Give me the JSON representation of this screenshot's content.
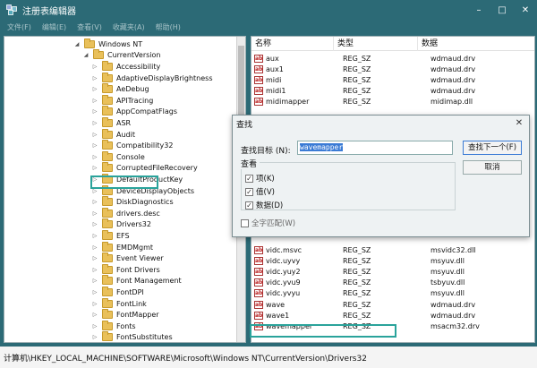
{
  "window": {
    "title": "注册表编辑器"
  },
  "menu": [
    "文件(F)",
    "编辑(E)",
    "查看(V)",
    "收藏夹(A)",
    "帮助(H)"
  ],
  "tree": {
    "nodes": [
      {
        "label": "Windows NT",
        "level": 0,
        "expanded": true
      },
      {
        "label": "CurrentVersion",
        "level": 1,
        "expanded": true
      },
      {
        "label": "Accessibility",
        "level": 2
      },
      {
        "label": "AdaptiveDisplayBrightness",
        "level": 2
      },
      {
        "label": "AeDebug",
        "level": 2
      },
      {
        "label": "APITracing",
        "level": 2
      },
      {
        "label": "AppCompatFlags",
        "level": 2
      },
      {
        "label": "ASR",
        "level": 2
      },
      {
        "label": "Audit",
        "level": 2
      },
      {
        "label": "Compatibility32",
        "level": 2
      },
      {
        "label": "Console",
        "level": 2
      },
      {
        "label": "CorruptedFileRecovery",
        "level": 2
      },
      {
        "label": "DefaultProductKey",
        "level": 2
      },
      {
        "label": "DeviceDisplayObjects",
        "level": 2
      },
      {
        "label": "DiskDiagnostics",
        "level": 2
      },
      {
        "label": "drivers.desc",
        "level": 2
      },
      {
        "label": "Drivers32",
        "level": 2,
        "selected": true
      },
      {
        "label": "EFS",
        "level": 2
      },
      {
        "label": "EMDMgmt",
        "level": 2
      },
      {
        "label": "Event Viewer",
        "level": 2
      },
      {
        "label": "Font Drivers",
        "level": 2
      },
      {
        "label": "Font Management",
        "level": 2
      },
      {
        "label": "FontDPI",
        "level": 2
      },
      {
        "label": "FontLink",
        "level": 2
      },
      {
        "label": "FontMapper",
        "level": 2
      },
      {
        "label": "Fonts",
        "level": 2
      },
      {
        "label": "FontSubstitutes",
        "level": 2
      }
    ]
  },
  "list": {
    "headers": {
      "name": "名称",
      "type": "类型",
      "data": "数据"
    },
    "rows_top": [
      {
        "name": "aux",
        "type": "REG_SZ",
        "data": "wdmaud.drv"
      },
      {
        "name": "aux1",
        "type": "REG_SZ",
        "data": "wdmaud.drv"
      },
      {
        "name": "midi",
        "type": "REG_SZ",
        "data": "wdmaud.drv"
      },
      {
        "name": "midi1",
        "type": "REG_SZ",
        "data": "wdmaud.drv"
      },
      {
        "name": "midimapper",
        "type": "REG_SZ",
        "data": "midimap.dll"
      }
    ],
    "rows_bottom": [
      {
        "name": "vidc.msvc",
        "type": "REG_SZ",
        "data": "msvidc32.dll"
      },
      {
        "name": "vidc.uyvy",
        "type": "REG_SZ",
        "data": "msyuv.dll"
      },
      {
        "name": "vidc.yuy2",
        "type": "REG_SZ",
        "data": "msyuv.dll"
      },
      {
        "name": "vidc.yvu9",
        "type": "REG_SZ",
        "data": "tsbyuv.dll"
      },
      {
        "name": "vidc.yvyu",
        "type": "REG_SZ",
        "data": "msyuv.dll"
      },
      {
        "name": "wave",
        "type": "REG_SZ",
        "data": "wdmaud.drv"
      },
      {
        "name": "wave1",
        "type": "REG_SZ",
        "data": "wdmaud.drv"
      },
      {
        "name": "wavemapper",
        "type": "REG_SZ",
        "data": "msacm32.drv"
      }
    ]
  },
  "status": "计算机\\HKEY_LOCAL_MACHINE\\SOFTWARE\\Microsoft\\Windows NT\\CurrentVersion\\Drivers32",
  "find_dialog": {
    "title": "查找",
    "target_label": "查找目标 (N):",
    "target_value": "wavemapper",
    "find_next": "查找下一个(F)",
    "cancel": "取消",
    "look_at": "查看",
    "opt_keys": "项(K)",
    "opt_values": "值(V)",
    "opt_data": "数据(D)",
    "whole_string": "全字匹配(W)"
  }
}
